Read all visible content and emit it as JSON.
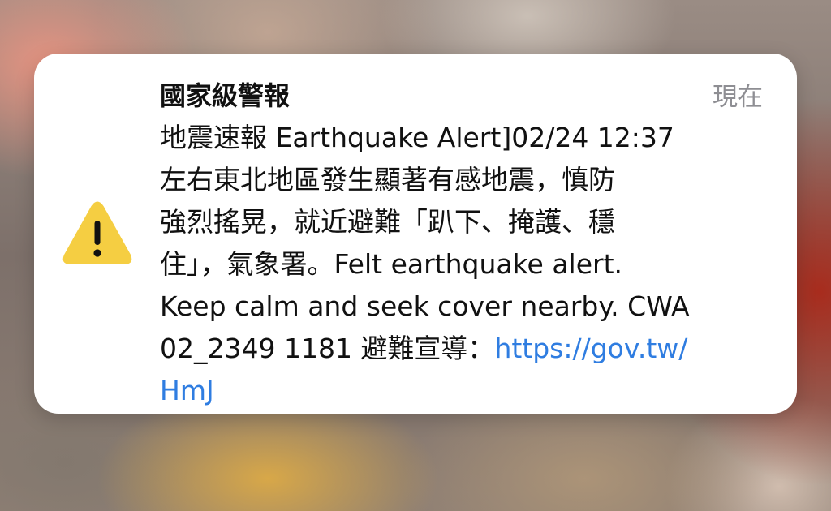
{
  "alert": {
    "title": "國家級警報",
    "timestamp": "現在",
    "icon": "warning-triangle-icon",
    "icon_color": "#F5CE42",
    "body_lines": [
      "地震速報 Earthquake Alert]02/24 12:37",
      "左右東北地區發生顯著有感地震，慎防",
      "強烈搖晃，就近避難「趴下、掩護、穩",
      "住」，氣象署。Felt earthquake alert.",
      "Keep calm and seek cover nearby. CWA"
    ],
    "last_line_prefix": "02_2349 1181 避難宣導：",
    "link_line1": "https://gov.tw/",
    "link_line2": "HmJ",
    "link_color": "#2F7DE1"
  }
}
